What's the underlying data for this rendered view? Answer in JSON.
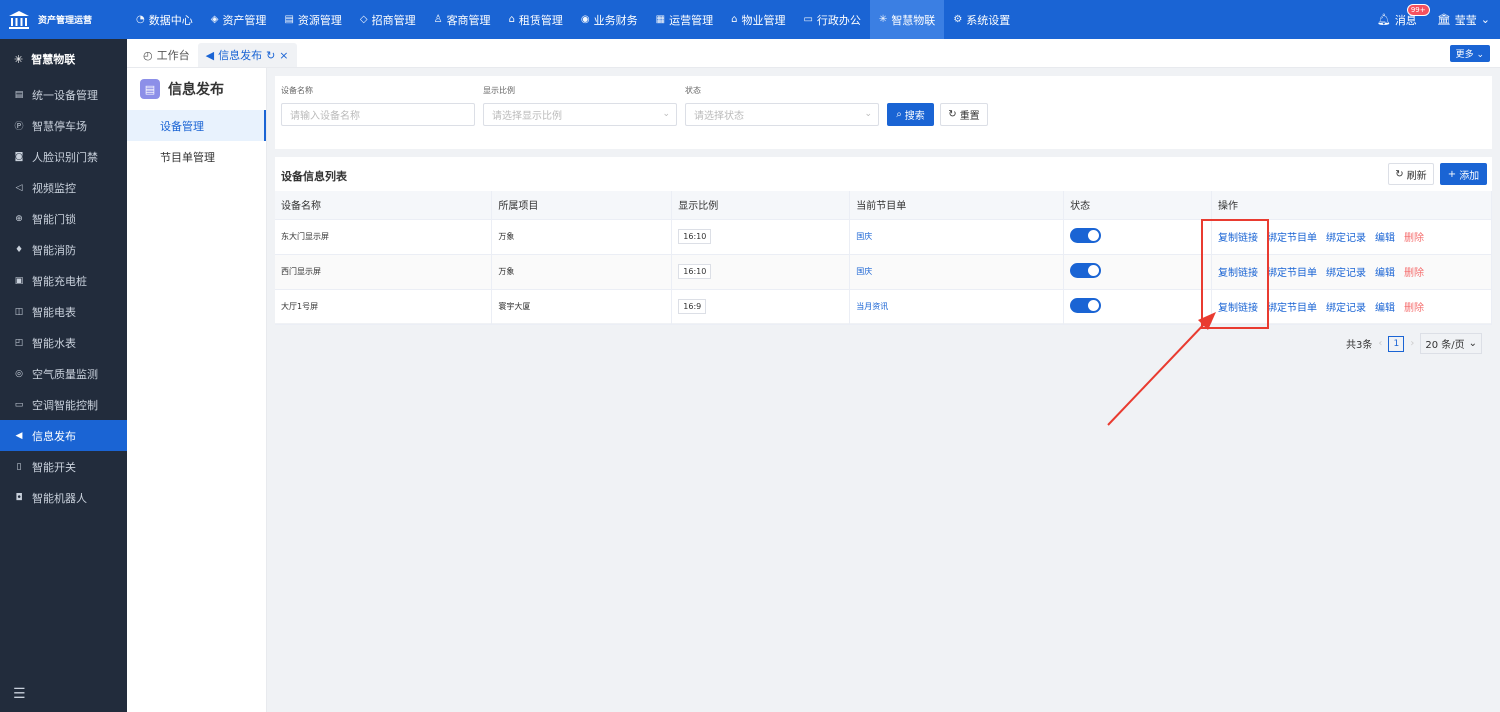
{
  "app": {
    "name": "资产管理运营"
  },
  "topnav": [
    {
      "label": "数据中心",
      "icon": "chart-icon"
    },
    {
      "label": "资产管理",
      "icon": "cube-icon"
    },
    {
      "label": "资源管理",
      "icon": "building-icon"
    },
    {
      "label": "招商管理",
      "icon": "tag-icon"
    },
    {
      "label": "客商管理",
      "icon": "people-icon"
    },
    {
      "label": "租赁管理",
      "icon": "home-icon"
    },
    {
      "label": "业务财务",
      "icon": "coin-icon"
    },
    {
      "label": "运营管理",
      "icon": "grid-icon"
    },
    {
      "label": "物业管理",
      "icon": "house-icon"
    },
    {
      "label": "行政办公",
      "icon": "monitor-icon"
    },
    {
      "label": "智慧物联",
      "icon": "iot-icon"
    },
    {
      "label": "系统设置",
      "icon": "gear-icon"
    }
  ],
  "header": {
    "messages_label": "消息",
    "messages_badge": "99+",
    "user_name": "莹莹"
  },
  "sidebar": {
    "title": "智慧物联",
    "items": [
      {
        "label": "统一设备管理"
      },
      {
        "label": "智慧停车场"
      },
      {
        "label": "人脸识别门禁"
      },
      {
        "label": "视频监控"
      },
      {
        "label": "智能门锁"
      },
      {
        "label": "智能消防"
      },
      {
        "label": "智能充电桩"
      },
      {
        "label": "智能电表"
      },
      {
        "label": "智能水表"
      },
      {
        "label": "空气质量监测"
      },
      {
        "label": "空调智能控制"
      },
      {
        "label": "信息发布"
      },
      {
        "label": "智能开关"
      },
      {
        "label": "智能机器人"
      }
    ]
  },
  "tabs": [
    {
      "label": "工作台"
    },
    {
      "label": "信息发布"
    }
  ],
  "more_label": "更多",
  "submenu": {
    "title": "信息发布",
    "items": [
      {
        "label": "设备管理"
      },
      {
        "label": "节目单管理"
      }
    ]
  },
  "filters": {
    "device_name": {
      "label": "设备名称",
      "placeholder": "请输入设备名称"
    },
    "ratio": {
      "label": "显示比例",
      "placeholder": "请选择显示比例"
    },
    "status": {
      "label": "状态",
      "placeholder": "请选择状态"
    },
    "search_label": "搜索",
    "reset_label": "重置"
  },
  "table": {
    "title": "设备信息列表",
    "refresh_label": "刷新",
    "add_label": "添加",
    "columns": [
      "设备名称",
      "所属项目",
      "显示比例",
      "当前节目单",
      "状态",
      "操作"
    ],
    "rows": [
      {
        "name": "东大门显示屏",
        "project": "万象",
        "ratio": "16:10",
        "program": "国庆",
        "enabled": true
      },
      {
        "name": "西门显示屏",
        "project": "万象",
        "ratio": "16:10",
        "program": "国庆",
        "enabled": true
      },
      {
        "name": "大厅1号屏",
        "project": "寰宇大厦",
        "ratio": "16:9",
        "program": "当月资讯",
        "enabled": true
      }
    ],
    "actions": {
      "copy": "复制链接",
      "bind": "绑定节目单",
      "record": "绑定记录",
      "edit": "编辑",
      "delete": "删除"
    }
  },
  "pagination": {
    "total_text": "共3条",
    "page": "1",
    "page_size": "20 条/页"
  },
  "colors": {
    "primary": "#1a64d4",
    "sidebar_bg": "#222c3c",
    "danger": "#f56c6c",
    "annotation": "#e93b30"
  }
}
